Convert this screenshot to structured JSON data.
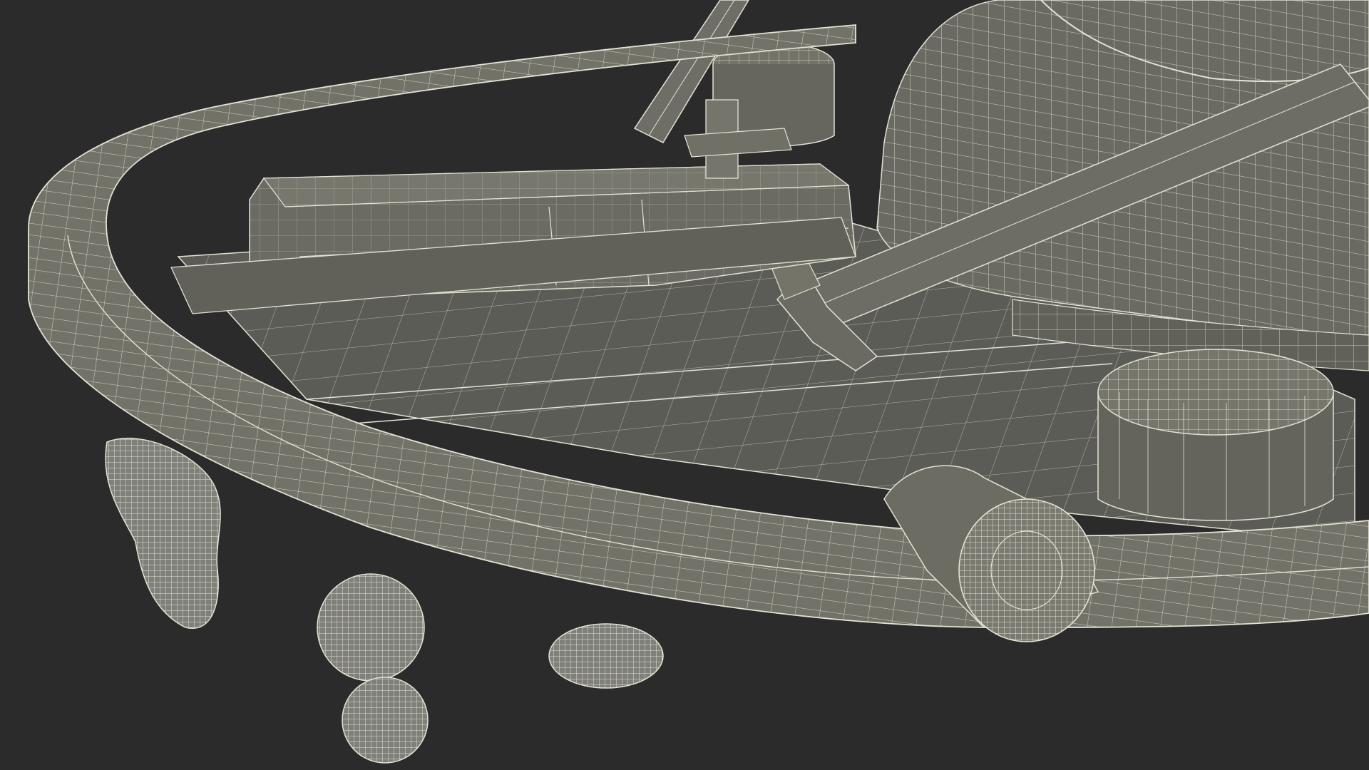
{
  "scene": {
    "background_color": "#2b2b2b",
    "mesh_fill_color": "#6f6f67",
    "mesh_shadow_color": "#55554f",
    "wire_color": "#e4e2d4",
    "view_mode": "wireframe-on-shaded",
    "subject": "go-kart-chassis-model",
    "parts": [
      {
        "id": "front-bumper-rail",
        "kind": "curved-tube"
      },
      {
        "id": "floor-pan",
        "kind": "panel"
      },
      {
        "id": "pedal-bracket-box",
        "kind": "box"
      },
      {
        "id": "steering-column",
        "kind": "tube"
      },
      {
        "id": "seat-shell",
        "kind": "shell"
      },
      {
        "id": "side-pod-cylinder",
        "kind": "cylinder"
      },
      {
        "id": "rear-cap-cylinder",
        "kind": "cylinder"
      },
      {
        "id": "front-wheel-hub",
        "kind": "hub"
      },
      {
        "id": "caster-wheel-left",
        "kind": "blob"
      },
      {
        "id": "caster-wheel-center",
        "kind": "blob"
      },
      {
        "id": "caster-wheel-right",
        "kind": "blob"
      }
    ]
  }
}
